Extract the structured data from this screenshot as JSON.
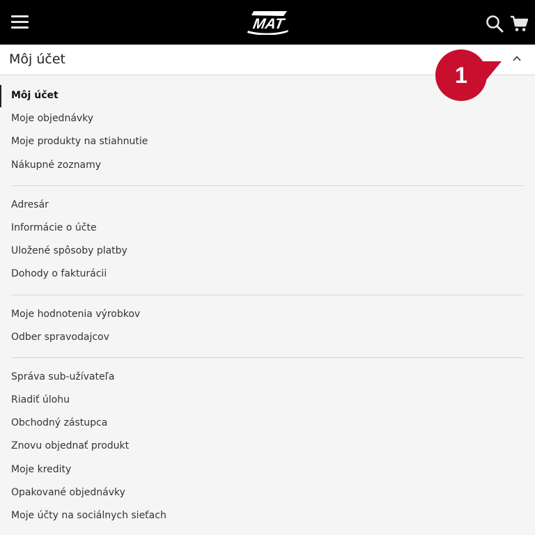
{
  "header": {
    "logo_text": "MAT",
    "menu_icon": "hamburger-menu-icon",
    "search_icon": "search-icon",
    "cart_icon": "shopping-cart-icon"
  },
  "account": {
    "title": "Môj účet",
    "toggle_icon": "chevron-up-icon"
  },
  "callout": {
    "number": "1",
    "color": "#c8102e"
  },
  "nav": {
    "group1": [
      "Môj účet",
      "Moje objednávky",
      "Moje produkty na stiahnutie",
      "Nákupné zoznamy"
    ],
    "group2": [
      "Adresár",
      "Informácie o účte",
      "Uložené spôsoby platby",
      "Dohody o fakturácii"
    ],
    "group3": [
      "Moje hodnotenia výrobkov",
      "Odber spravodajcov"
    ],
    "group4": [
      "Správa sub-užívateľa",
      "Riadiť úlohu",
      "Obchodný zástupca",
      "Znovu objednať produkt",
      "Moje kredity",
      "Opakované objednávky",
      "Moje účty na sociálnych sieťach"
    ]
  }
}
